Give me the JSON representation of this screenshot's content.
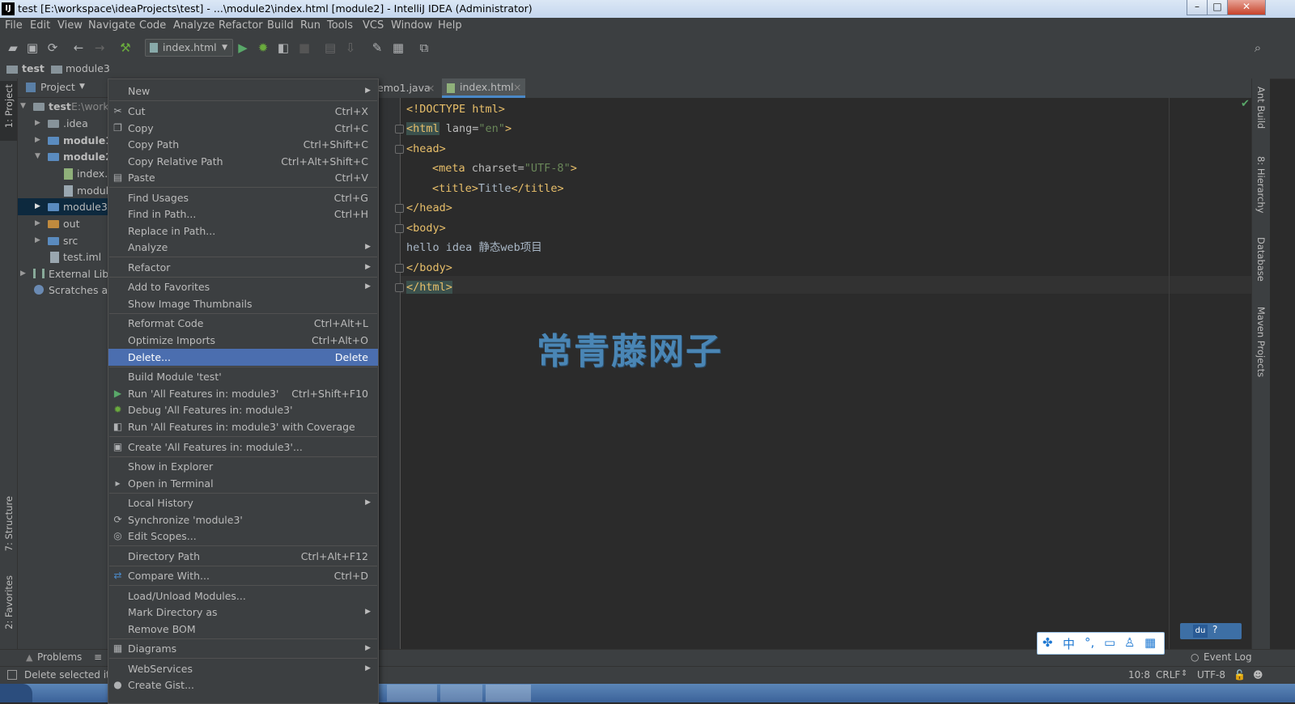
{
  "window": {
    "title": "test [E:\\workspace\\ideaProjects\\test] - ...\\module2\\index.html [module2] - IntelliJ IDEA (Administrator)",
    "app_icon_text": "IJ"
  },
  "menubar": {
    "items": [
      "File",
      "Edit",
      "View",
      "Navigate",
      "Code",
      "Analyze",
      "Refactor",
      "Build",
      "Run",
      "Tools",
      "VCS",
      "Window",
      "Help"
    ]
  },
  "toolbar": {
    "run_config": "index.html"
  },
  "navbar": {
    "crumbs": [
      "test",
      "module3"
    ]
  },
  "left_stripe": {
    "project_label": "1: Project",
    "structure_label": "7: Structure",
    "favorites_label": "2: Favorites"
  },
  "project_panel": {
    "header": "Project",
    "tree": [
      {
        "label": "test",
        "suffix": "E:\\work"
      },
      {
        "label": ".idea"
      },
      {
        "label": "module1"
      },
      {
        "label": "module2"
      },
      {
        "label": "index.h"
      },
      {
        "label": "modul"
      },
      {
        "label": "module3"
      },
      {
        "label": "out"
      },
      {
        "label": "src"
      },
      {
        "label": "test.iml"
      },
      {
        "label": "External Libra"
      },
      {
        "label": "Scratches an"
      }
    ]
  },
  "tabs": [
    {
      "label": "emo1.java",
      "close": "×"
    },
    {
      "label": "index.html",
      "close": "×"
    }
  ],
  "code": {
    "l1_tag": "<!DOCTYPE html>",
    "l2_tag": "<html",
    "l2_attr": " lang=",
    "l2_str": "\"en\"",
    "l2_close": ">",
    "l3_tag": "<head>",
    "l4_tag": "<meta",
    "l4_attr": " charset=",
    "l4_str": "\"UTF-8\"",
    "l4_close": ">",
    "l5_open": "<title>",
    "l5_text": "Title",
    "l5_close": "</title>",
    "l6_tag": "</head>",
    "l7_tag": "<body>",
    "l8_text": "hello idea 静态web项目",
    "l9_tag": "</body>",
    "l10_tag": "</html>"
  },
  "context_menu": {
    "new": "New",
    "cut": "Cut",
    "cut_sc": "Ctrl+X",
    "copy": "Copy",
    "copy_sc": "Ctrl+C",
    "copy_path": "Copy Path",
    "copy_path_sc": "Ctrl+Shift+C",
    "copy_rel": "Copy Relative Path",
    "copy_rel_sc": "Ctrl+Alt+Shift+C",
    "paste": "Paste",
    "paste_sc": "Ctrl+V",
    "find_usages": "Find Usages",
    "find_usages_sc": "Ctrl+G",
    "find_in_path": "Find in Path...",
    "find_in_path_sc": "Ctrl+H",
    "replace_in_path": "Replace in Path...",
    "analyze": "Analyze",
    "refactor": "Refactor",
    "add_fav": "Add to Favorites",
    "show_thumbs": "Show Image Thumbnails",
    "reformat": "Reformat Code",
    "reformat_sc": "Ctrl+Alt+L",
    "optimize": "Optimize Imports",
    "optimize_sc": "Ctrl+Alt+O",
    "delete": "Delete...",
    "delete_sc": "Delete",
    "build_module": "Build Module 'test'",
    "run_all": "Run 'All Features in: module3'",
    "run_all_sc": "Ctrl+Shift+F10",
    "debug_all": "Debug 'All Features in: module3'",
    "run_cov": "Run 'All Features in: module3' with Coverage",
    "create_all": "Create 'All Features in: module3'...",
    "show_explorer": "Show in Explorer",
    "open_terminal": "Open in Terminal",
    "local_history": "Local History",
    "sync": "Synchronize 'module3'",
    "edit_scopes": "Edit Scopes...",
    "dir_path": "Directory Path",
    "dir_path_sc": "Ctrl+Alt+F12",
    "compare": "Compare With...",
    "compare_sc": "Ctrl+D",
    "load_unload": "Load/Unload Modules...",
    "mark_dir": "Mark Directory as",
    "remove_bom": "Remove BOM",
    "diagrams": "Diagrams",
    "webservices": "WebServices",
    "create_gist": "Create Gist..."
  },
  "right_stripe": {
    "ant": "Ant Build",
    "hierarchy": "8: Hierarchy",
    "database": "Database",
    "maven": "Maven Projects"
  },
  "bottom": {
    "problems": "Problems",
    "event_log": "Event Log"
  },
  "status": {
    "message": "Delete selected ite",
    "position": "10:8",
    "line_sep": "CRLF",
    "encoding": "UTF-8"
  },
  "watermark": "常青藤网子",
  "ime": {
    "lang": "中"
  }
}
